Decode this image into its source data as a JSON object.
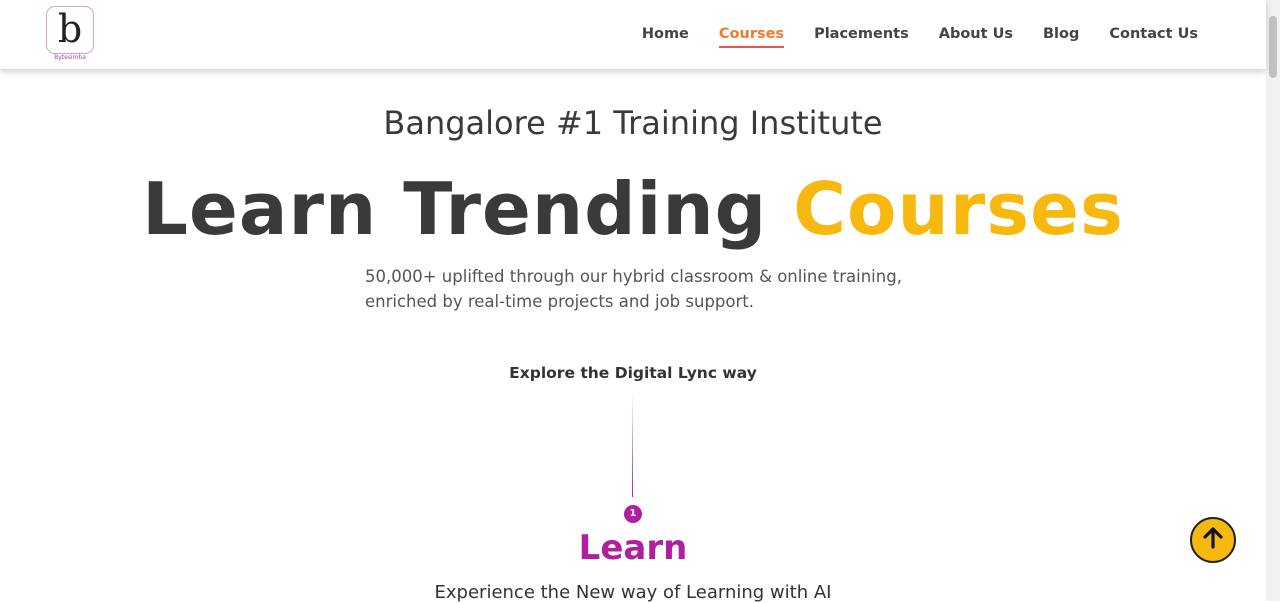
{
  "brand": {
    "logo_letter": "b",
    "logo_text": "Bytesimba"
  },
  "nav": {
    "items": [
      "Home",
      "Courses",
      "Placements",
      "About Us",
      "Blog",
      "Contact Us"
    ],
    "active": "Courses"
  },
  "hero": {
    "kicker": "Bangalore #1 Training Institute",
    "headline_main": "Learn Trending ",
    "headline_highlight": "Courses",
    "subtext_line1": "50,000+ uplifted through our hybrid classroom & online training,",
    "subtext_line2": "enriched by real-time projects and job support."
  },
  "explore": {
    "title": "Explore the Digital Lync way"
  },
  "step": {
    "number": "1",
    "title": "Learn",
    "description": "Experience the New way of Learning with AI"
  },
  "icons": {
    "scroll_top": "arrow-up-icon"
  },
  "colors": {
    "accent_yellow": "#f7b90f",
    "accent_purple": "#b01fa0",
    "nav_active": "#f07b2c",
    "nav_underline": "#e8584b",
    "heading": "#3a3a3a"
  }
}
